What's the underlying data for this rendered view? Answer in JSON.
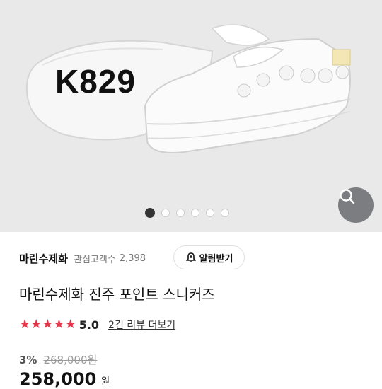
{
  "gallery": {
    "model_code": "K829",
    "image_count": 6,
    "active_index": 0
  },
  "seller": {
    "name": "마린수제화",
    "fans_label": "관심고객수",
    "fans_count": "2,398",
    "alert_button": "알림받기"
  },
  "product": {
    "title": "마린수제화 진주 포인트 스니커즈",
    "rating": "5.0",
    "stars": 5,
    "review_link": "2건 리뷰 더보기",
    "discount": "3%",
    "original_price": "268,000원",
    "price": "258,000",
    "price_unit": "원"
  },
  "icons": {
    "zoom": "search-icon",
    "alert": "bell-plus-icon",
    "rating": "star-icon"
  },
  "colors": {
    "star": "#e8374b",
    "zoom_button": "#7b7d80"
  }
}
